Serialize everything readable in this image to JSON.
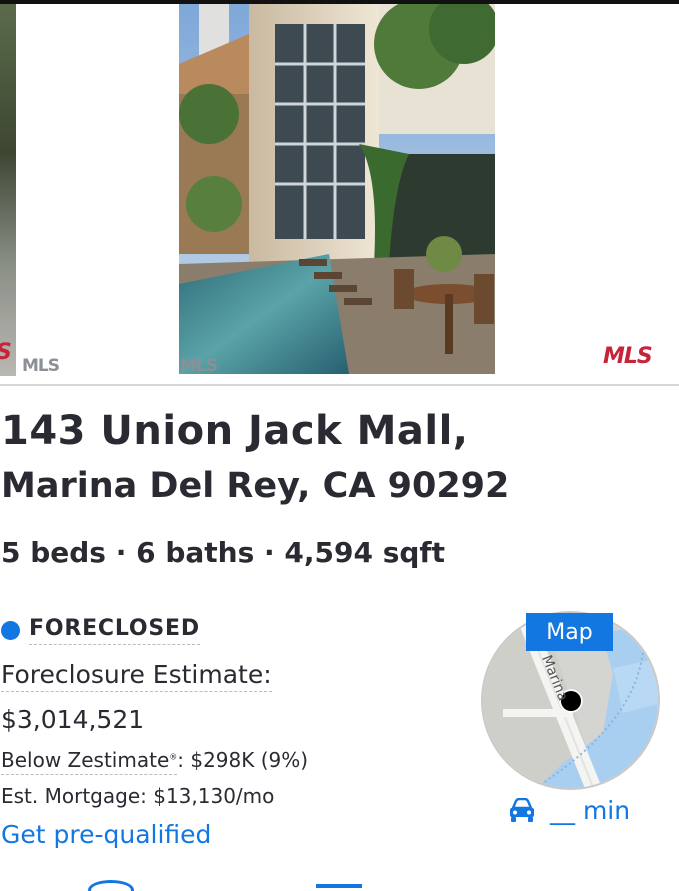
{
  "gallery": {
    "watermark_left": "MLS",
    "watermark_main": "MLS",
    "watermark_right": "MLS"
  },
  "listing": {
    "address_line1": "143 Union Jack Mall,",
    "address_line2": "Marina Del Rey, CA 90292",
    "facts": "5 beds · 6 baths · 4,594 sqft",
    "status": "FORECLOSED",
    "status_color": "#1277e1",
    "estimate_label": "Foreclosure Estimate:",
    "estimate_value": "$3,014,521",
    "zestimate_label": "Below Zestimate",
    "zestimate_mark": "®",
    "zestimate_value": ": $298K (9%)",
    "mortgage": "Est. Mortgage: $13,130/mo",
    "prequal_link": "Get pre-qualified"
  },
  "map": {
    "label": "Map",
    "street_label": "Marina",
    "drive_icon": "car-icon",
    "drive_time": "__ min"
  },
  "colors": {
    "accent": "#1277e1",
    "text": "#2a2a33"
  }
}
